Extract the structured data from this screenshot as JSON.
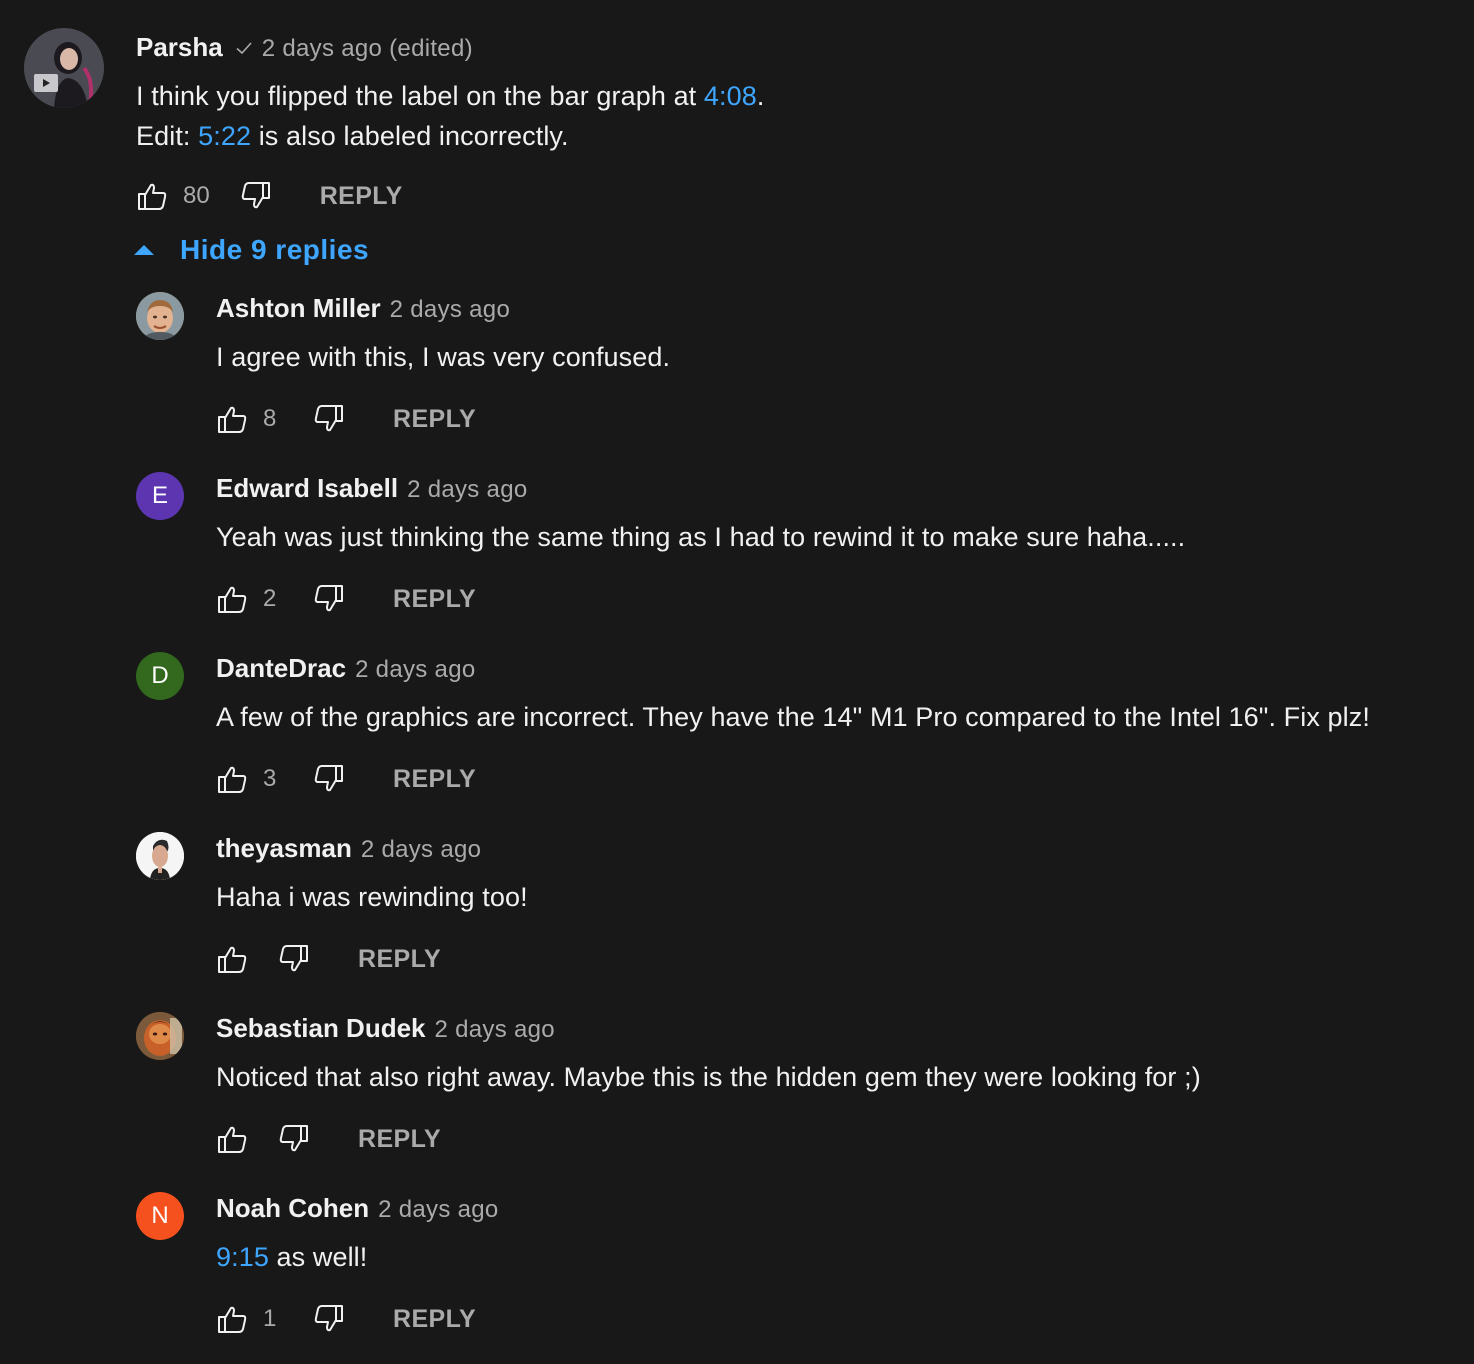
{
  "top_comment": {
    "author": "Parsha",
    "time": "2 days ago (edited)",
    "line1_text": "I think you flipped the label on the bar graph at ",
    "line1_ts": "4:08",
    "line1_end": ".",
    "line2_text": "Edit: ",
    "line2_ts": "5:22",
    "line2_end": " is also labeled incorrectly.",
    "likes": "80",
    "reply_label": "REPLY"
  },
  "toggle_label": "Hide 9 replies",
  "replies": [
    {
      "author": "Ashton Miller",
      "time": "2 days ago",
      "text": "I agree with this, I was very confused.",
      "likes": "8",
      "reply_label": "REPLY",
      "avatar_color": "#c9a27a"
    },
    {
      "author": "Edward Isabell",
      "time": "2 days ago",
      "text": "Yeah was just thinking the same thing as I had to rewind it to make sure haha.....",
      "likes": "2",
      "reply_label": "REPLY",
      "avatar_letter": "E",
      "avatar_color": "#5e35b1"
    },
    {
      "author": "DanteDrac",
      "time": "2 days ago",
      "text": "A few of the graphics are incorrect.  They have the 14\" M1 Pro compared to the Intel 16\".  Fix plz!",
      "likes": "3",
      "reply_label": "REPLY",
      "avatar_letter": "D",
      "avatar_color": "#33691e"
    },
    {
      "author": "theyasman",
      "time": "2 days ago",
      "text": "Haha i was rewinding too!",
      "likes": "",
      "reply_label": "REPLY",
      "avatar_color": "#f5f5f5"
    },
    {
      "author": "Sebastian Dudek",
      "time": "2 days ago",
      "text": "Noticed that also right away. Maybe this is the hidden gem they were looking for ;)",
      "likes": "",
      "reply_label": "REPLY",
      "avatar_color": "#a0522d"
    },
    {
      "author": "Noah Cohen",
      "time": "2 days ago",
      "text_ts": "9:15",
      "text": " as well!",
      "likes": "1",
      "reply_label": "REPLY",
      "avatar_letter": "N",
      "avatar_color": "#f4511e"
    }
  ],
  "colors": {
    "background": "#181818",
    "link": "#3ea6ff",
    "secondary_text": "#aaaaaa",
    "primary_text": "#f1f1f1"
  }
}
